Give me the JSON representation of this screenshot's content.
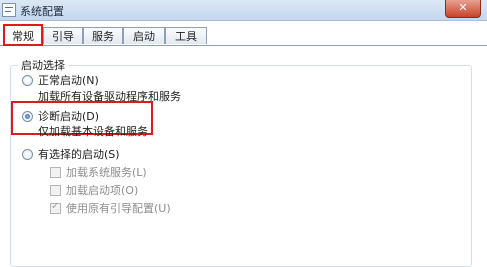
{
  "window": {
    "title": "系统配置",
    "close_label": "✕"
  },
  "tabs": [
    {
      "label": "常规",
      "active": true
    },
    {
      "label": "引导",
      "active": false
    },
    {
      "label": "服务",
      "active": false
    },
    {
      "label": "启动",
      "active": false
    },
    {
      "label": "工具",
      "active": false
    }
  ],
  "startup": {
    "group_label": "启动选择",
    "options": [
      {
        "label": "正常启动(N)",
        "description": "加载所有设备驱动程序和服务",
        "selected": false
      },
      {
        "label": "诊断启动(D)",
        "description": "仅加载基本设备和服务",
        "selected": true
      },
      {
        "label": "有选择的启动(S)",
        "selected": false
      }
    ],
    "selective_items": [
      {
        "label": "加载系统服务(L)",
        "checked": false,
        "enabled": false
      },
      {
        "label": "加载启动项(O)",
        "checked": false,
        "enabled": false
      },
      {
        "label": "使用原有引导配置(U)",
        "checked": true,
        "enabled": false
      }
    ]
  },
  "colors": {
    "highlight": "#e01919",
    "accent": "#2862b5"
  }
}
